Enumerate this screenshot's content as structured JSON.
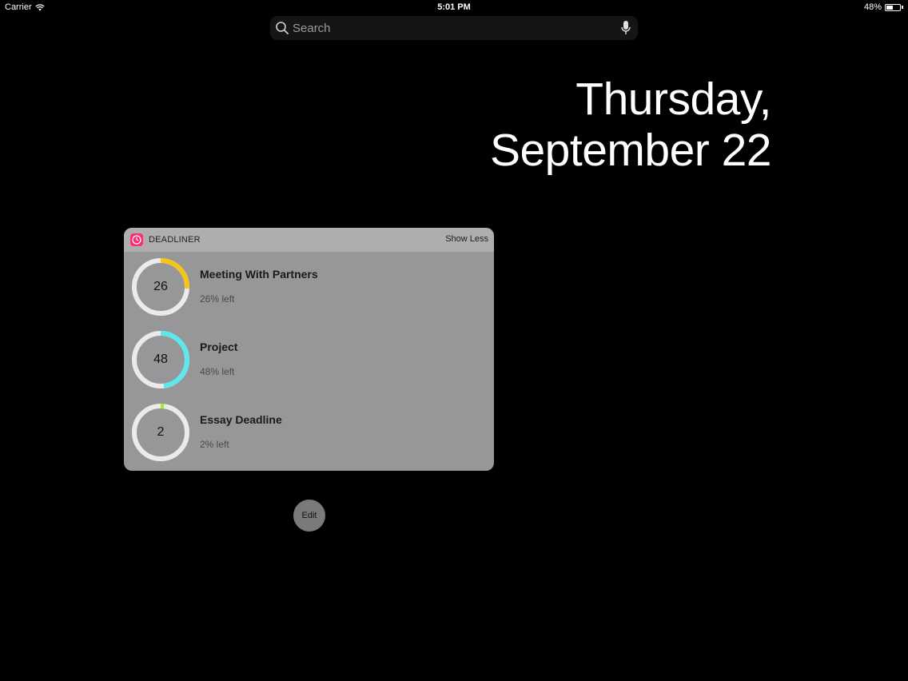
{
  "status_bar": {
    "carrier": "Carrier",
    "time": "5:01 PM",
    "battery_text": "48%",
    "battery_level": 0.48
  },
  "search": {
    "placeholder": "Search",
    "icons": [
      "search-icon",
      "microphone-icon"
    ]
  },
  "date": {
    "line1": "Thursday,",
    "line2": "September 22"
  },
  "widget": {
    "app_name": "DEADLINER",
    "show_less_label": "Show Less",
    "accent": "#ff2d6f",
    "items": [
      {
        "number": "26",
        "title": "Meeting With Partners",
        "subtitle": "26% left",
        "percent": 26,
        "color": "#f5c518"
      },
      {
        "number": "48",
        "title": "Project",
        "subtitle": "48% left",
        "percent": 48,
        "color": "#5ee8ec"
      },
      {
        "number": "2",
        "title": "Essay Deadline",
        "subtitle": "2% left",
        "percent": 2,
        "color": "#9cf226"
      }
    ]
  },
  "edit_button": {
    "label": "Edit"
  }
}
